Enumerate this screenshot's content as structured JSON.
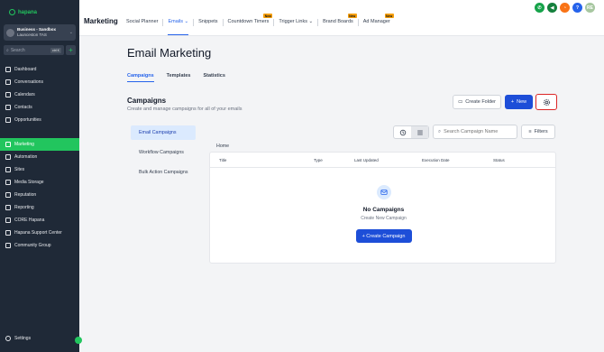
{
  "sidebar": {
    "logo": "hapana",
    "account": {
      "name": "Business - Sandbox",
      "location": "Launceston TAS"
    },
    "search": {
      "placeholder": "Search",
      "shortcut": "ctrl K"
    },
    "items": [
      {
        "label": "Dashboard",
        "icon": "dashboard-icon"
      },
      {
        "label": "Conversations",
        "icon": "chat-icon"
      },
      {
        "label": "Calendars",
        "icon": "calendar-icon"
      },
      {
        "label": "Contacts",
        "icon": "contacts-icon"
      },
      {
        "label": "Opportunities",
        "icon": "opportunities-icon"
      },
      {
        "label": "Marketing",
        "icon": "marketing-icon",
        "active": true
      },
      {
        "label": "Automation",
        "icon": "automation-icon"
      },
      {
        "label": "Sites",
        "icon": "sites-icon"
      },
      {
        "label": "Media Storage",
        "icon": "media-icon"
      },
      {
        "label": "Reputation",
        "icon": "star-icon"
      },
      {
        "label": "Reporting",
        "icon": "reporting-icon"
      },
      {
        "label": "CORE Hapana",
        "icon": "core-icon"
      },
      {
        "label": "Hapana Support Center",
        "icon": "support-icon"
      },
      {
        "label": "Community Group",
        "icon": "community-icon"
      }
    ],
    "settings": "Settings"
  },
  "topbar": {
    "module": "Marketing",
    "nav": [
      {
        "label": "Social Planner"
      },
      {
        "label": "Emails",
        "active": true,
        "caret": true
      },
      {
        "label": "Snippets"
      },
      {
        "label": "Countdown Timers",
        "badge": "New"
      },
      {
        "label": "Trigger Links",
        "caret": true
      },
      {
        "label": "Brand Boards",
        "badge": "New"
      },
      {
        "label": "Ad Manager",
        "badge": "New"
      }
    ],
    "user_initials": "RE",
    "colors": {
      "phone": "#16a34a",
      "megaphone": "#15803d",
      "bell": "#f97316",
      "help": "#2563eb",
      "avatar": "#a7c7a0"
    }
  },
  "main": {
    "title": "Email Marketing",
    "tabs": [
      "Campaigns",
      "Templates",
      "Statistics"
    ],
    "section_title": "Campaigns",
    "section_subtitle": "Create and manage campaigns for all of your emails",
    "create_folder": "Create Folder",
    "new_button": "New",
    "side_tabs": [
      "Email Campaigns",
      "Workflow Campaigns",
      "Bulk Action Campaigns"
    ],
    "search_placeholder": "Search Campaign Name",
    "filters": "Filters",
    "breadcrumb": "Home",
    "columns": [
      "Title",
      "Type",
      "Last Updated",
      "Execution Date",
      "Status"
    ],
    "empty_title": "No Campaigns",
    "empty_subtitle": "Create New Campaign",
    "create_campaign": "+ Create Campaign"
  }
}
